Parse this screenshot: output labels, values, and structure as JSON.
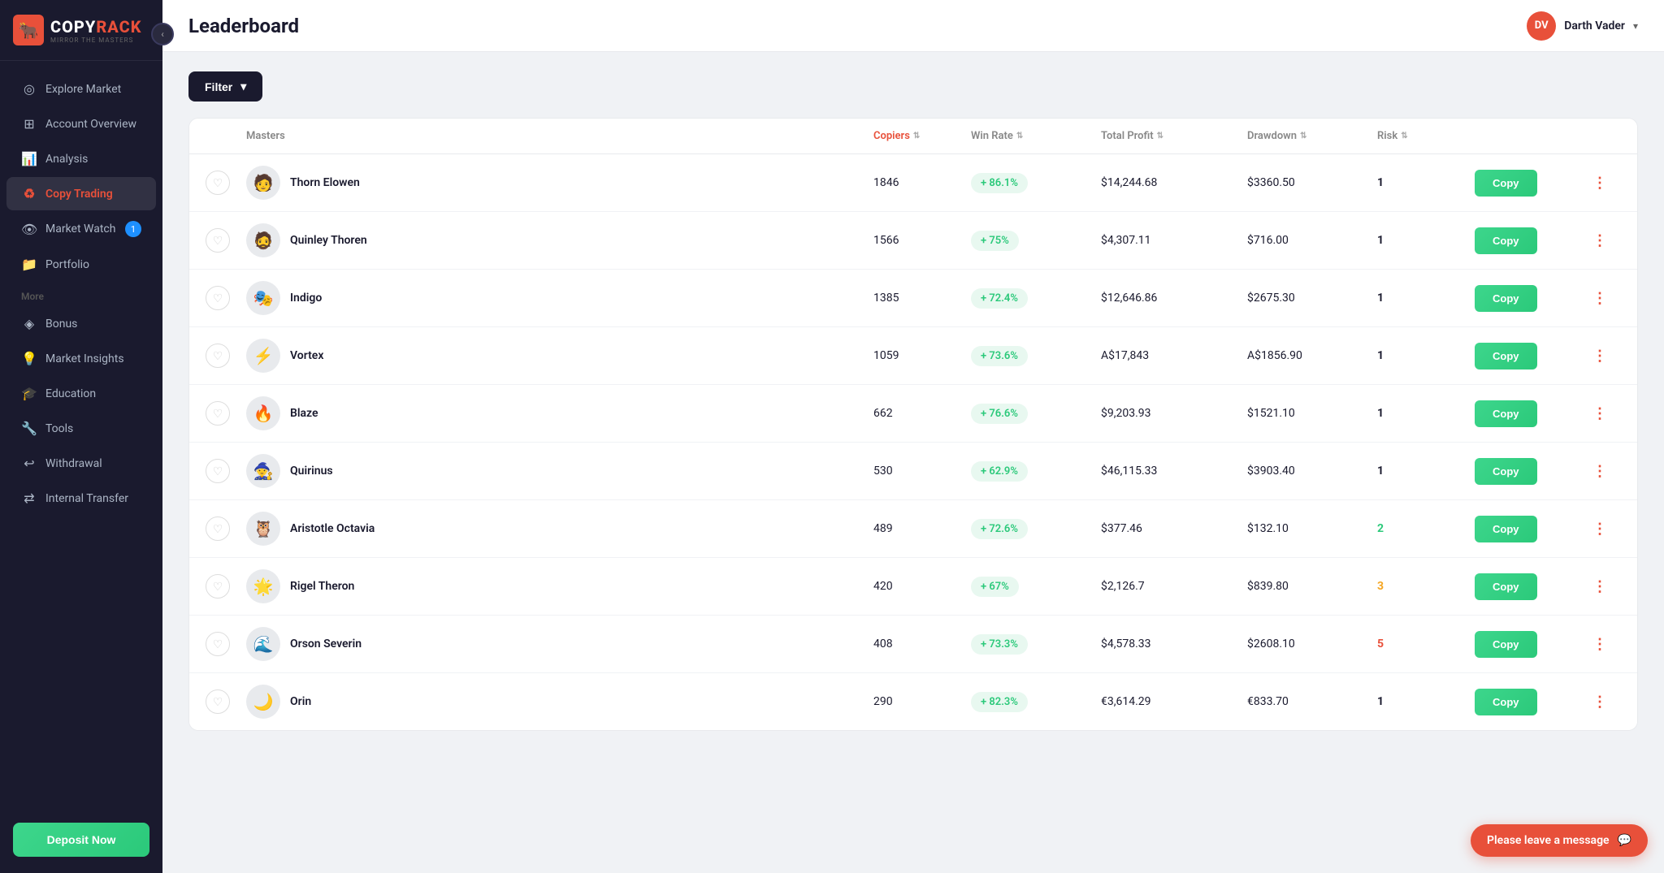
{
  "sidebar": {
    "logo": {
      "copy": "COPY",
      "rack": "RACK",
      "tagline": "MIRROR THE MASTERS"
    },
    "nav_items": [
      {
        "id": "explore-market",
        "label": "Explore Market",
        "icon": "◎",
        "active": false
      },
      {
        "id": "account-overview",
        "label": "Account Overview",
        "icon": "⊞",
        "active": false
      },
      {
        "id": "analysis",
        "label": "Analysis",
        "icon": "📊",
        "active": false
      },
      {
        "id": "copy-trading",
        "label": "Copy Trading",
        "icon": "♻",
        "active": true
      },
      {
        "id": "market-watch",
        "label": "Market Watch",
        "icon": "👁",
        "active": false,
        "badge": "1"
      }
    ],
    "more_label": "More",
    "more_items": [
      {
        "id": "bonus",
        "label": "Bonus",
        "icon": "◈"
      },
      {
        "id": "market-insights",
        "label": "Market Insights",
        "icon": "💡"
      },
      {
        "id": "education",
        "label": "Education",
        "icon": "🎓"
      },
      {
        "id": "tools",
        "label": "Tools",
        "icon": "🔧"
      },
      {
        "id": "withdrawal",
        "label": "Withdrawal",
        "icon": "↩"
      },
      {
        "id": "internal-transfer",
        "label": "Internal Transfer",
        "icon": "⇄"
      }
    ],
    "portfolio_label": "Portfolio",
    "deposit_btn": "Deposit Now"
  },
  "header": {
    "title": "Leaderboard",
    "user": {
      "initials": "DV",
      "name": "Darth Vader"
    }
  },
  "filter": {
    "label": "Filter"
  },
  "table": {
    "columns": {
      "masters": "Masters",
      "copiers": "Copiers",
      "win_rate": "Win Rate",
      "total_profit": "Total Profit",
      "drawdown": "Drawdown",
      "risk": "Risk"
    },
    "copy_label": "Copy",
    "rows": [
      {
        "id": 1,
        "name": "Thorn Elowen",
        "avatar": "🧑",
        "copiers": "1846",
        "win_rate": "+ 86.1%",
        "total_profit": "$14,244.68",
        "drawdown": "$3360.50",
        "risk": "1",
        "risk_class": "risk-1"
      },
      {
        "id": 2,
        "name": "Quinley Thoren",
        "avatar": "🧔",
        "copiers": "1566",
        "win_rate": "+ 75%",
        "total_profit": "$4,307.11",
        "drawdown": "$716.00",
        "risk": "1",
        "risk_class": "risk-1"
      },
      {
        "id": 3,
        "name": "Indigo",
        "avatar": "🎭",
        "copiers": "1385",
        "win_rate": "+ 72.4%",
        "total_profit": "$12,646.86",
        "drawdown": "$2675.30",
        "risk": "1",
        "risk_class": "risk-1"
      },
      {
        "id": 4,
        "name": "Vortex",
        "avatar": "⚡",
        "copiers": "1059",
        "win_rate": "+ 73.6%",
        "total_profit": "A$17,843",
        "drawdown": "A$1856.90",
        "risk": "1",
        "risk_class": "risk-1"
      },
      {
        "id": 5,
        "name": "Blaze",
        "avatar": "🔥",
        "copiers": "662",
        "win_rate": "+ 76.6%",
        "total_profit": "$9,203.93",
        "drawdown": "$1521.10",
        "risk": "1",
        "risk_class": "risk-1"
      },
      {
        "id": 6,
        "name": "Quirinus",
        "avatar": "🧙",
        "copiers": "530",
        "win_rate": "+ 62.9%",
        "total_profit": "$46,115.33",
        "drawdown": "$3903.40",
        "risk": "1",
        "risk_class": "risk-1"
      },
      {
        "id": 7,
        "name": "Aristotle Octavia",
        "avatar": "🦉",
        "copiers": "489",
        "win_rate": "+ 72.6%",
        "total_profit": "$377.46",
        "drawdown": "$132.10",
        "risk": "2",
        "risk_class": "risk-2"
      },
      {
        "id": 8,
        "name": "Rigel Theron",
        "avatar": "🌟",
        "copiers": "420",
        "win_rate": "+ 67%",
        "total_profit": "$2,126.7",
        "drawdown": "$839.80",
        "risk": "3",
        "risk_class": "risk-3"
      },
      {
        "id": 9,
        "name": "Orson Severin",
        "avatar": "🌊",
        "copiers": "408",
        "win_rate": "+ 73.3%",
        "total_profit": "$4,578.33",
        "drawdown": "$2608.10",
        "risk": "5",
        "risk_class": "risk-5"
      },
      {
        "id": 10,
        "name": "Orin",
        "avatar": "🌙",
        "copiers": "290",
        "win_rate": "+ 82.3%",
        "total_profit": "€3,614.29",
        "drawdown": "€833.70",
        "risk": "1",
        "risk_class": "risk-1"
      }
    ]
  },
  "chat_widget": {
    "label": "Please leave a message",
    "icon": "💬"
  }
}
